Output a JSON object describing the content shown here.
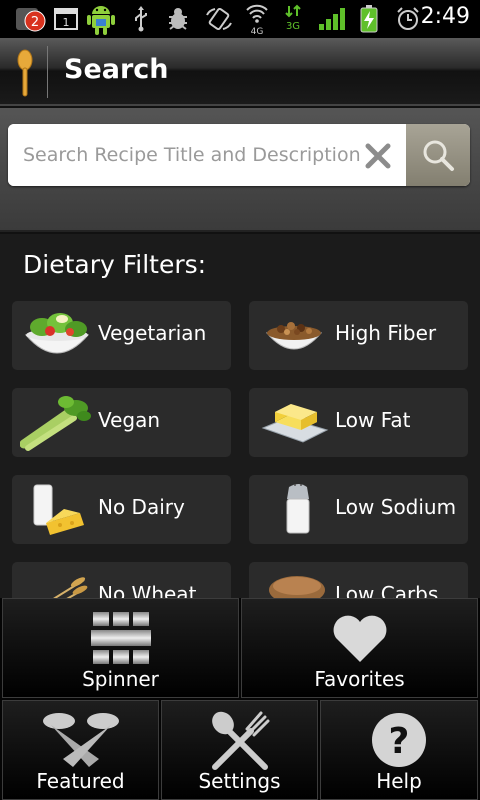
{
  "status_bar": {
    "notification_count": "2",
    "sim_slot": "1",
    "network_4g": "4G",
    "network_3g": "3G",
    "time": "2:49"
  },
  "titlebar": {
    "title": "Search",
    "app_icon": "spoon-icon"
  },
  "search": {
    "placeholder": "Search Recipe Title and Description",
    "value": "",
    "clear_icon": "close-icon",
    "search_icon": "search-icon"
  },
  "filters": {
    "heading": "Dietary Filters:",
    "items": [
      {
        "label": "Vegetarian",
        "icon": "salad-icon"
      },
      {
        "label": "High Fiber",
        "icon": "cereal-bowl-icon"
      },
      {
        "label": "Vegan",
        "icon": "celery-icon"
      },
      {
        "label": "Low Fat",
        "icon": "butter-icon"
      },
      {
        "label": "No Dairy",
        "icon": "milk-cheese-icon"
      },
      {
        "label": "Low Sodium",
        "icon": "salt-shaker-icon"
      },
      {
        "label": "No Wheat",
        "icon": "wheat-icon"
      },
      {
        "label": "Low Carbs",
        "icon": "bread-icon"
      }
    ]
  },
  "menu": {
    "items": [
      {
        "label": "Spinner",
        "icon": "spinner-grid-icon"
      },
      {
        "label": "Favorites",
        "icon": "heart-icon"
      },
      {
        "label": "Featured",
        "icon": "spotlight-icon"
      },
      {
        "label": "Settings",
        "icon": "fork-spoon-icon"
      },
      {
        "label": "Help",
        "icon": "help-icon"
      }
    ]
  }
}
